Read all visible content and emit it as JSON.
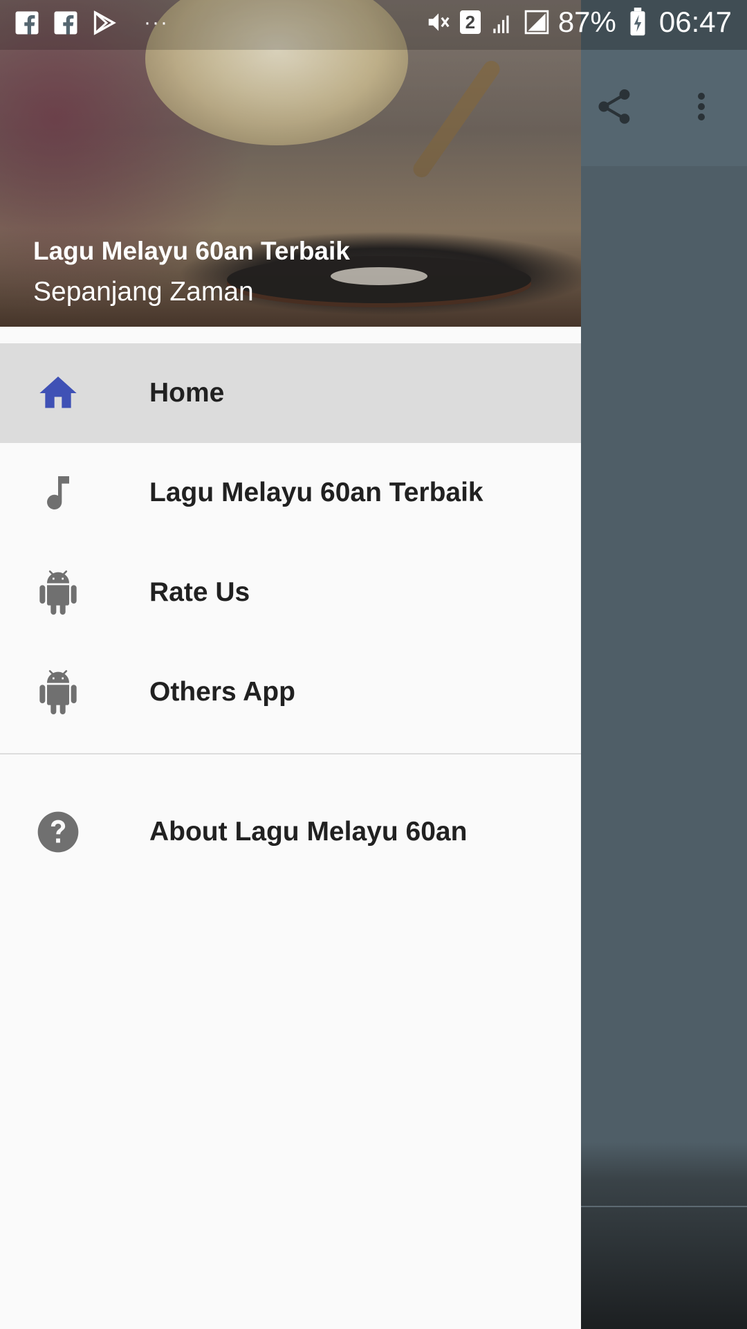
{
  "status_bar": {
    "battery": "87%",
    "time": "06:47",
    "sim_badge": "2",
    "overflow": "···"
  },
  "drawer": {
    "header": {
      "title": "Lagu Melayu 60an Terbaik",
      "subtitle": "Sepanjang Zaman"
    },
    "items": [
      {
        "label": "Home",
        "icon": "home-icon",
        "active": true
      },
      {
        "label": "Lagu Melayu 60an Terbaik",
        "icon": "music-note-icon"
      },
      {
        "label": "Rate Us",
        "icon": "android-icon"
      },
      {
        "label": "Others App",
        "icon": "android-icon"
      }
    ],
    "secondary_items": [
      {
        "label": "About Lagu Melayu 60an",
        "icon": "help-icon"
      }
    ]
  },
  "toolbar": {
    "actions": [
      "share-icon",
      "more-vert-icon"
    ]
  },
  "colors": {
    "accent": "#3f51b5",
    "drawer_bg": "#fafafa",
    "active_bg": "#dcdcdc",
    "scrim": "#4f5e67"
  }
}
